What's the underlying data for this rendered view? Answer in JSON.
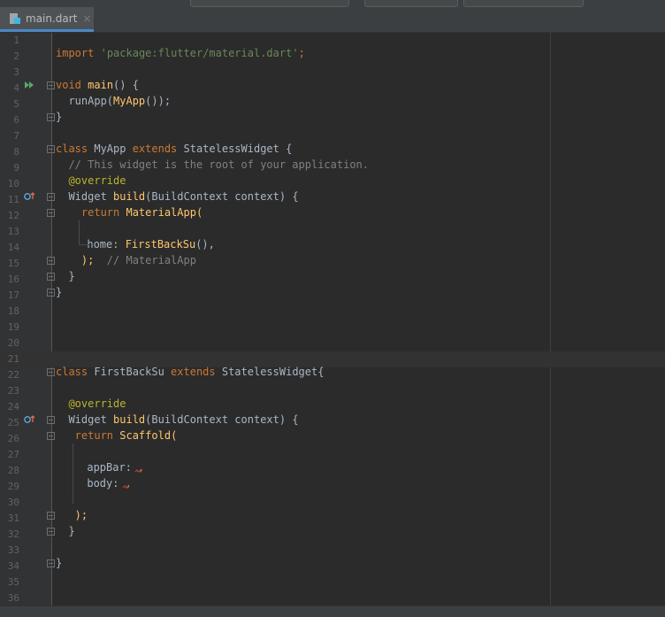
{
  "tab": {
    "label": "main.dart",
    "close": "×"
  },
  "lines": [
    {
      "n": "1"
    },
    {
      "n": "2"
    },
    {
      "n": "3"
    },
    {
      "n": "4"
    },
    {
      "n": "5"
    },
    {
      "n": "6"
    },
    {
      "n": "7"
    },
    {
      "n": "8"
    },
    {
      "n": "9"
    },
    {
      "n": "10"
    },
    {
      "n": "11"
    },
    {
      "n": "12"
    },
    {
      "n": "13"
    },
    {
      "n": "14"
    },
    {
      "n": "15"
    },
    {
      "n": "16"
    },
    {
      "n": "17"
    },
    {
      "n": "18"
    },
    {
      "n": "19"
    },
    {
      "n": "20"
    },
    {
      "n": "21"
    },
    {
      "n": "22"
    },
    {
      "n": "23"
    },
    {
      "n": "24"
    },
    {
      "n": "25"
    },
    {
      "n": "26"
    },
    {
      "n": "27"
    },
    {
      "n": "28"
    },
    {
      "n": "29"
    },
    {
      "n": "30"
    },
    {
      "n": "31"
    },
    {
      "n": "32"
    },
    {
      "n": "33"
    },
    {
      "n": "34"
    },
    {
      "n": "35"
    },
    {
      "n": "36"
    }
  ],
  "code": {
    "l2_import": "import",
    "l2_str": "'package:flutter/material.dart'",
    "l2_semi": ";",
    "l4_void": "void",
    "l4_main": "main",
    "l4_rest": "() {",
    "l5_run": "  runApp(",
    "l5_myapp": "MyApp",
    "l5_rest": "());",
    "l6": "}",
    "l8_class": "class",
    "l8_name": " MyApp ",
    "l8_extends": "extends",
    "l8_rest": " StatelessWidget {",
    "l9": "  // This widget is the root of your application.",
    "l10": "  @override",
    "l11_widget": "  Widget ",
    "l11_build": "build",
    "l11_rest": "(BuildContext context) {",
    "l12_ret": "    return",
    "l12_mat": " MaterialApp",
    "l12_paren": "(",
    "l14_home": "      home: ",
    "l14_fbs": "FirstBackSu",
    "l14_rest": "(),",
    "l15_close": "    );",
    "l15_cm": "  // MaterialApp",
    "l16": "  }",
    "l17": "}",
    "l22_class": "class",
    "l22_name": " FirstBackSu ",
    "l22_extends": "extends",
    "l22_rest": " StatelessWidget{",
    "l24": "  @override",
    "l25_widget": "  Widget ",
    "l25_build": "build",
    "l25_rest": "(BuildContext context) {",
    "l26_ret": "   return",
    "l26_sc": " Scaffold",
    "l26_paren": "(",
    "l28": "      appBar: ",
    "l28_comma": ",",
    "l29": "      body: ",
    "l29_comma": ",",
    "l31": "   );",
    "l32": "  }",
    "l34": "}"
  },
  "colors": {
    "background": "#2b2b2b",
    "gutter": "#313335",
    "keyword": "#cc7832",
    "string": "#6a8759",
    "function": "#ffc66d",
    "comment": "#808080",
    "annotation": "#bbb529",
    "text": "#a9b7c6",
    "tab_accent": "#4a88c7"
  }
}
